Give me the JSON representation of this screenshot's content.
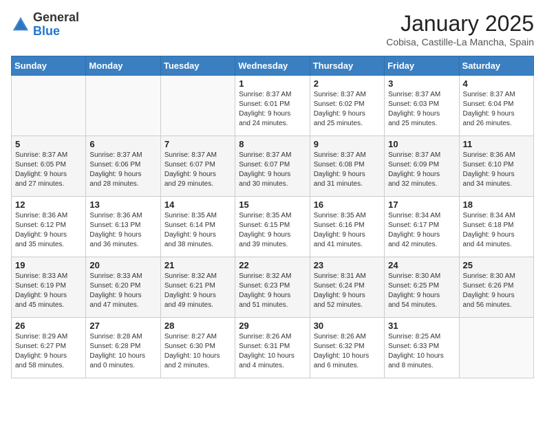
{
  "logo": {
    "general": "General",
    "blue": "Blue"
  },
  "header": {
    "title": "January 2025",
    "subtitle": "Cobisa, Castille-La Mancha, Spain"
  },
  "weekdays": [
    "Sunday",
    "Monday",
    "Tuesday",
    "Wednesday",
    "Thursday",
    "Friday",
    "Saturday"
  ],
  "weeks": [
    [
      {
        "day": "",
        "info": ""
      },
      {
        "day": "",
        "info": ""
      },
      {
        "day": "",
        "info": ""
      },
      {
        "day": "1",
        "info": "Sunrise: 8:37 AM\nSunset: 6:01 PM\nDaylight: 9 hours\nand 24 minutes."
      },
      {
        "day": "2",
        "info": "Sunrise: 8:37 AM\nSunset: 6:02 PM\nDaylight: 9 hours\nand 25 minutes."
      },
      {
        "day": "3",
        "info": "Sunrise: 8:37 AM\nSunset: 6:03 PM\nDaylight: 9 hours\nand 25 minutes."
      },
      {
        "day": "4",
        "info": "Sunrise: 8:37 AM\nSunset: 6:04 PM\nDaylight: 9 hours\nand 26 minutes."
      }
    ],
    [
      {
        "day": "5",
        "info": "Sunrise: 8:37 AM\nSunset: 6:05 PM\nDaylight: 9 hours\nand 27 minutes."
      },
      {
        "day": "6",
        "info": "Sunrise: 8:37 AM\nSunset: 6:06 PM\nDaylight: 9 hours\nand 28 minutes."
      },
      {
        "day": "7",
        "info": "Sunrise: 8:37 AM\nSunset: 6:07 PM\nDaylight: 9 hours\nand 29 minutes."
      },
      {
        "day": "8",
        "info": "Sunrise: 8:37 AM\nSunset: 6:07 PM\nDaylight: 9 hours\nand 30 minutes."
      },
      {
        "day": "9",
        "info": "Sunrise: 8:37 AM\nSunset: 6:08 PM\nDaylight: 9 hours\nand 31 minutes."
      },
      {
        "day": "10",
        "info": "Sunrise: 8:37 AM\nSunset: 6:09 PM\nDaylight: 9 hours\nand 32 minutes."
      },
      {
        "day": "11",
        "info": "Sunrise: 8:36 AM\nSunset: 6:10 PM\nDaylight: 9 hours\nand 34 minutes."
      }
    ],
    [
      {
        "day": "12",
        "info": "Sunrise: 8:36 AM\nSunset: 6:12 PM\nDaylight: 9 hours\nand 35 minutes."
      },
      {
        "day": "13",
        "info": "Sunrise: 8:36 AM\nSunset: 6:13 PM\nDaylight: 9 hours\nand 36 minutes."
      },
      {
        "day": "14",
        "info": "Sunrise: 8:35 AM\nSunset: 6:14 PM\nDaylight: 9 hours\nand 38 minutes."
      },
      {
        "day": "15",
        "info": "Sunrise: 8:35 AM\nSunset: 6:15 PM\nDaylight: 9 hours\nand 39 minutes."
      },
      {
        "day": "16",
        "info": "Sunrise: 8:35 AM\nSunset: 6:16 PM\nDaylight: 9 hours\nand 41 minutes."
      },
      {
        "day": "17",
        "info": "Sunrise: 8:34 AM\nSunset: 6:17 PM\nDaylight: 9 hours\nand 42 minutes."
      },
      {
        "day": "18",
        "info": "Sunrise: 8:34 AM\nSunset: 6:18 PM\nDaylight: 9 hours\nand 44 minutes."
      }
    ],
    [
      {
        "day": "19",
        "info": "Sunrise: 8:33 AM\nSunset: 6:19 PM\nDaylight: 9 hours\nand 45 minutes."
      },
      {
        "day": "20",
        "info": "Sunrise: 8:33 AM\nSunset: 6:20 PM\nDaylight: 9 hours\nand 47 minutes."
      },
      {
        "day": "21",
        "info": "Sunrise: 8:32 AM\nSunset: 6:21 PM\nDaylight: 9 hours\nand 49 minutes."
      },
      {
        "day": "22",
        "info": "Sunrise: 8:32 AM\nSunset: 6:23 PM\nDaylight: 9 hours\nand 51 minutes."
      },
      {
        "day": "23",
        "info": "Sunrise: 8:31 AM\nSunset: 6:24 PM\nDaylight: 9 hours\nand 52 minutes."
      },
      {
        "day": "24",
        "info": "Sunrise: 8:30 AM\nSunset: 6:25 PM\nDaylight: 9 hours\nand 54 minutes."
      },
      {
        "day": "25",
        "info": "Sunrise: 8:30 AM\nSunset: 6:26 PM\nDaylight: 9 hours\nand 56 minutes."
      }
    ],
    [
      {
        "day": "26",
        "info": "Sunrise: 8:29 AM\nSunset: 6:27 PM\nDaylight: 9 hours\nand 58 minutes."
      },
      {
        "day": "27",
        "info": "Sunrise: 8:28 AM\nSunset: 6:28 PM\nDaylight: 10 hours\nand 0 minutes."
      },
      {
        "day": "28",
        "info": "Sunrise: 8:27 AM\nSunset: 6:30 PM\nDaylight: 10 hours\nand 2 minutes."
      },
      {
        "day": "29",
        "info": "Sunrise: 8:26 AM\nSunset: 6:31 PM\nDaylight: 10 hours\nand 4 minutes."
      },
      {
        "day": "30",
        "info": "Sunrise: 8:26 AM\nSunset: 6:32 PM\nDaylight: 10 hours\nand 6 minutes."
      },
      {
        "day": "31",
        "info": "Sunrise: 8:25 AM\nSunset: 6:33 PM\nDaylight: 10 hours\nand 8 minutes."
      },
      {
        "day": "",
        "info": ""
      }
    ]
  ]
}
